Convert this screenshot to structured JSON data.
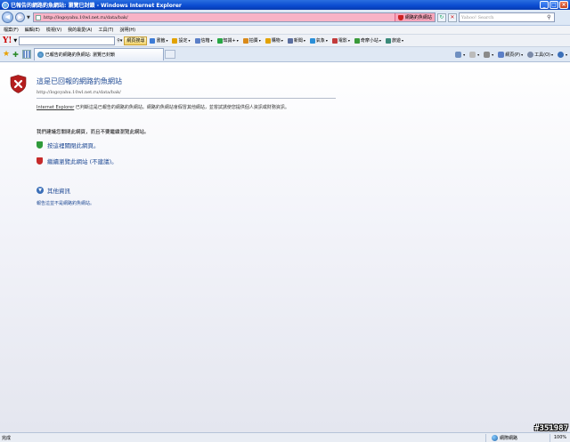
{
  "window": {
    "title": "已報告的網路釣魚網站: 瀏覽已封鎖 - Windows Internet Explorer",
    "minimize": "_",
    "maximize": "□",
    "close": "×"
  },
  "address_bar": {
    "url": "http://logoyahu.10wl.net.ru/data/bak/",
    "warning_label": "網路釣魚網站",
    "search_placeholder": "Yahoo! Search",
    "accent_color": "#f8b3c6"
  },
  "menu": [
    "檔案(F)",
    "編輯(E)",
    "檢視(V)",
    "我的最愛(A)",
    "工具(T)",
    "說明(H)"
  ],
  "yahoo_toolbar": {
    "logo": "Y!",
    "search_button": "網頁搜尋",
    "tools": [
      {
        "label": "書籤",
        "icon": "bookmark-icon",
        "color": "#3d7bd6"
      },
      {
        "label": "設定",
        "icon": "settings-icon",
        "color": "#e2a200"
      },
      {
        "label": "信箱",
        "icon": "mail-icon",
        "color": "#5b7fc7"
      },
      {
        "label": "知識+",
        "icon": "knowledge-icon",
        "color": "#28a745"
      },
      {
        "label": "拍賣",
        "icon": "auction-icon",
        "color": "#d98a1a"
      },
      {
        "label": "購物",
        "icon": "shopping-icon",
        "color": "#e2a200"
      },
      {
        "label": "新聞",
        "icon": "news-icon",
        "color": "#5b6fa0"
      },
      {
        "label": "氣象",
        "icon": "weather-icon",
        "color": "#2a8fd8"
      },
      {
        "label": "電影",
        "icon": "movie-icon",
        "color": "#c23b3b"
      },
      {
        "label": "奇摩小站",
        "icon": "club-icon",
        "color": "#3a9a3a"
      },
      {
        "label": "旅遊",
        "icon": "travel-icon",
        "color": "#3b8a7a"
      }
    ]
  },
  "tabs": [
    {
      "label": "已報告的網路釣魚網站: 瀏覽已封鎖"
    }
  ],
  "command_bar": [
    {
      "label": "網頁(P)",
      "icon": "page-icon",
      "color": "#5b7fc7"
    },
    {
      "label": "工具(O)",
      "icon": "tools-icon",
      "color": "#7a8aa8"
    }
  ],
  "content": {
    "heading": "這是已回報的網路釣魚網站",
    "url": "http://logoyahu.10wl.net.ru/data/bak/",
    "description_ie": "Internet Explorer",
    "description_rest": " 已判斷這是已報告的網路釣魚網站。網路釣魚網站會假冒其他網站，並嘗試誘使您提供個人資訊或財務資訊。",
    "advice": "我們建議您關閉此網頁，而且不要繼續瀏覽此網站。",
    "option_close": "按這裡關閉此網頁。",
    "option_continue": "繼續瀏覽此網站 (不建議)。",
    "more_info": "其他資訊",
    "report_link": "報告這並不是網路釣魚網站。"
  },
  "status_bar": {
    "status": "完成",
    "zone": "網際網路",
    "zoom": "100%",
    "watermark": "#351987"
  }
}
